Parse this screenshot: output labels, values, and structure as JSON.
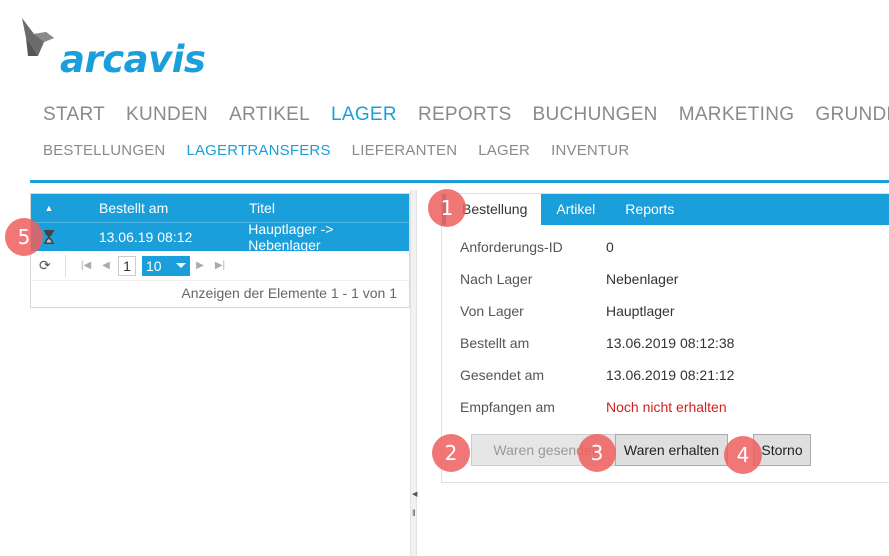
{
  "brand": {
    "name": "arcavis",
    "color": "#1a9fda"
  },
  "main_nav": [
    {
      "label": "START",
      "active": false
    },
    {
      "label": "KUNDEN",
      "active": false
    },
    {
      "label": "ARTIKEL",
      "active": false
    },
    {
      "label": "LAGER",
      "active": true
    },
    {
      "label": "REPORTS",
      "active": false
    },
    {
      "label": "BUCHUNGEN",
      "active": false
    },
    {
      "label": "MARKETING",
      "active": false
    },
    {
      "label": "GRUNDDAT",
      "active": false
    }
  ],
  "sub_nav": [
    {
      "label": "BESTELLUNGEN",
      "active": false
    },
    {
      "label": "LAGERTRANSFERS",
      "active": true
    },
    {
      "label": "LIEFERANTEN",
      "active": false
    },
    {
      "label": "LAGER",
      "active": false
    },
    {
      "label": "INVENTUR",
      "active": false
    }
  ],
  "grid": {
    "sort_icon": "sort-up-icon",
    "columns": {
      "date": "Bestellt am",
      "title": "Titel"
    },
    "rows": [
      {
        "status_icon": "hourglass-icon",
        "date": "13.06.19 08:12",
        "title": "Hauptlager -> Nebenlager"
      }
    ],
    "pager": {
      "refresh_icon": "refresh-icon",
      "current_page": "1",
      "page_size": "10",
      "info": "Anzeigen der Elemente 1 - 1 von 1"
    }
  },
  "tabs": [
    {
      "label": "Bestellung",
      "active": true
    },
    {
      "label": "Artikel",
      "active": false
    },
    {
      "label": "Reports",
      "active": false
    }
  ],
  "details": [
    {
      "label": "Anforderungs-ID",
      "value": "0"
    },
    {
      "label": "Nach Lager",
      "value": "Nebenlager"
    },
    {
      "label": "Von Lager",
      "value": "Hauptlager"
    },
    {
      "label": "Bestellt am",
      "value": "13.06.2019 08:12:38"
    },
    {
      "label": "Gesendet am",
      "value": "13.06.2019 08:21:12"
    },
    {
      "label": "Empfangen am",
      "value": "Noch nicht erhalten",
      "warn": true
    }
  ],
  "buttons": {
    "sent": "Waren gesendet",
    "received": "Waren erhalten",
    "cancel": "Storno"
  },
  "markers": [
    "1",
    "2",
    "3",
    "4",
    "5"
  ]
}
